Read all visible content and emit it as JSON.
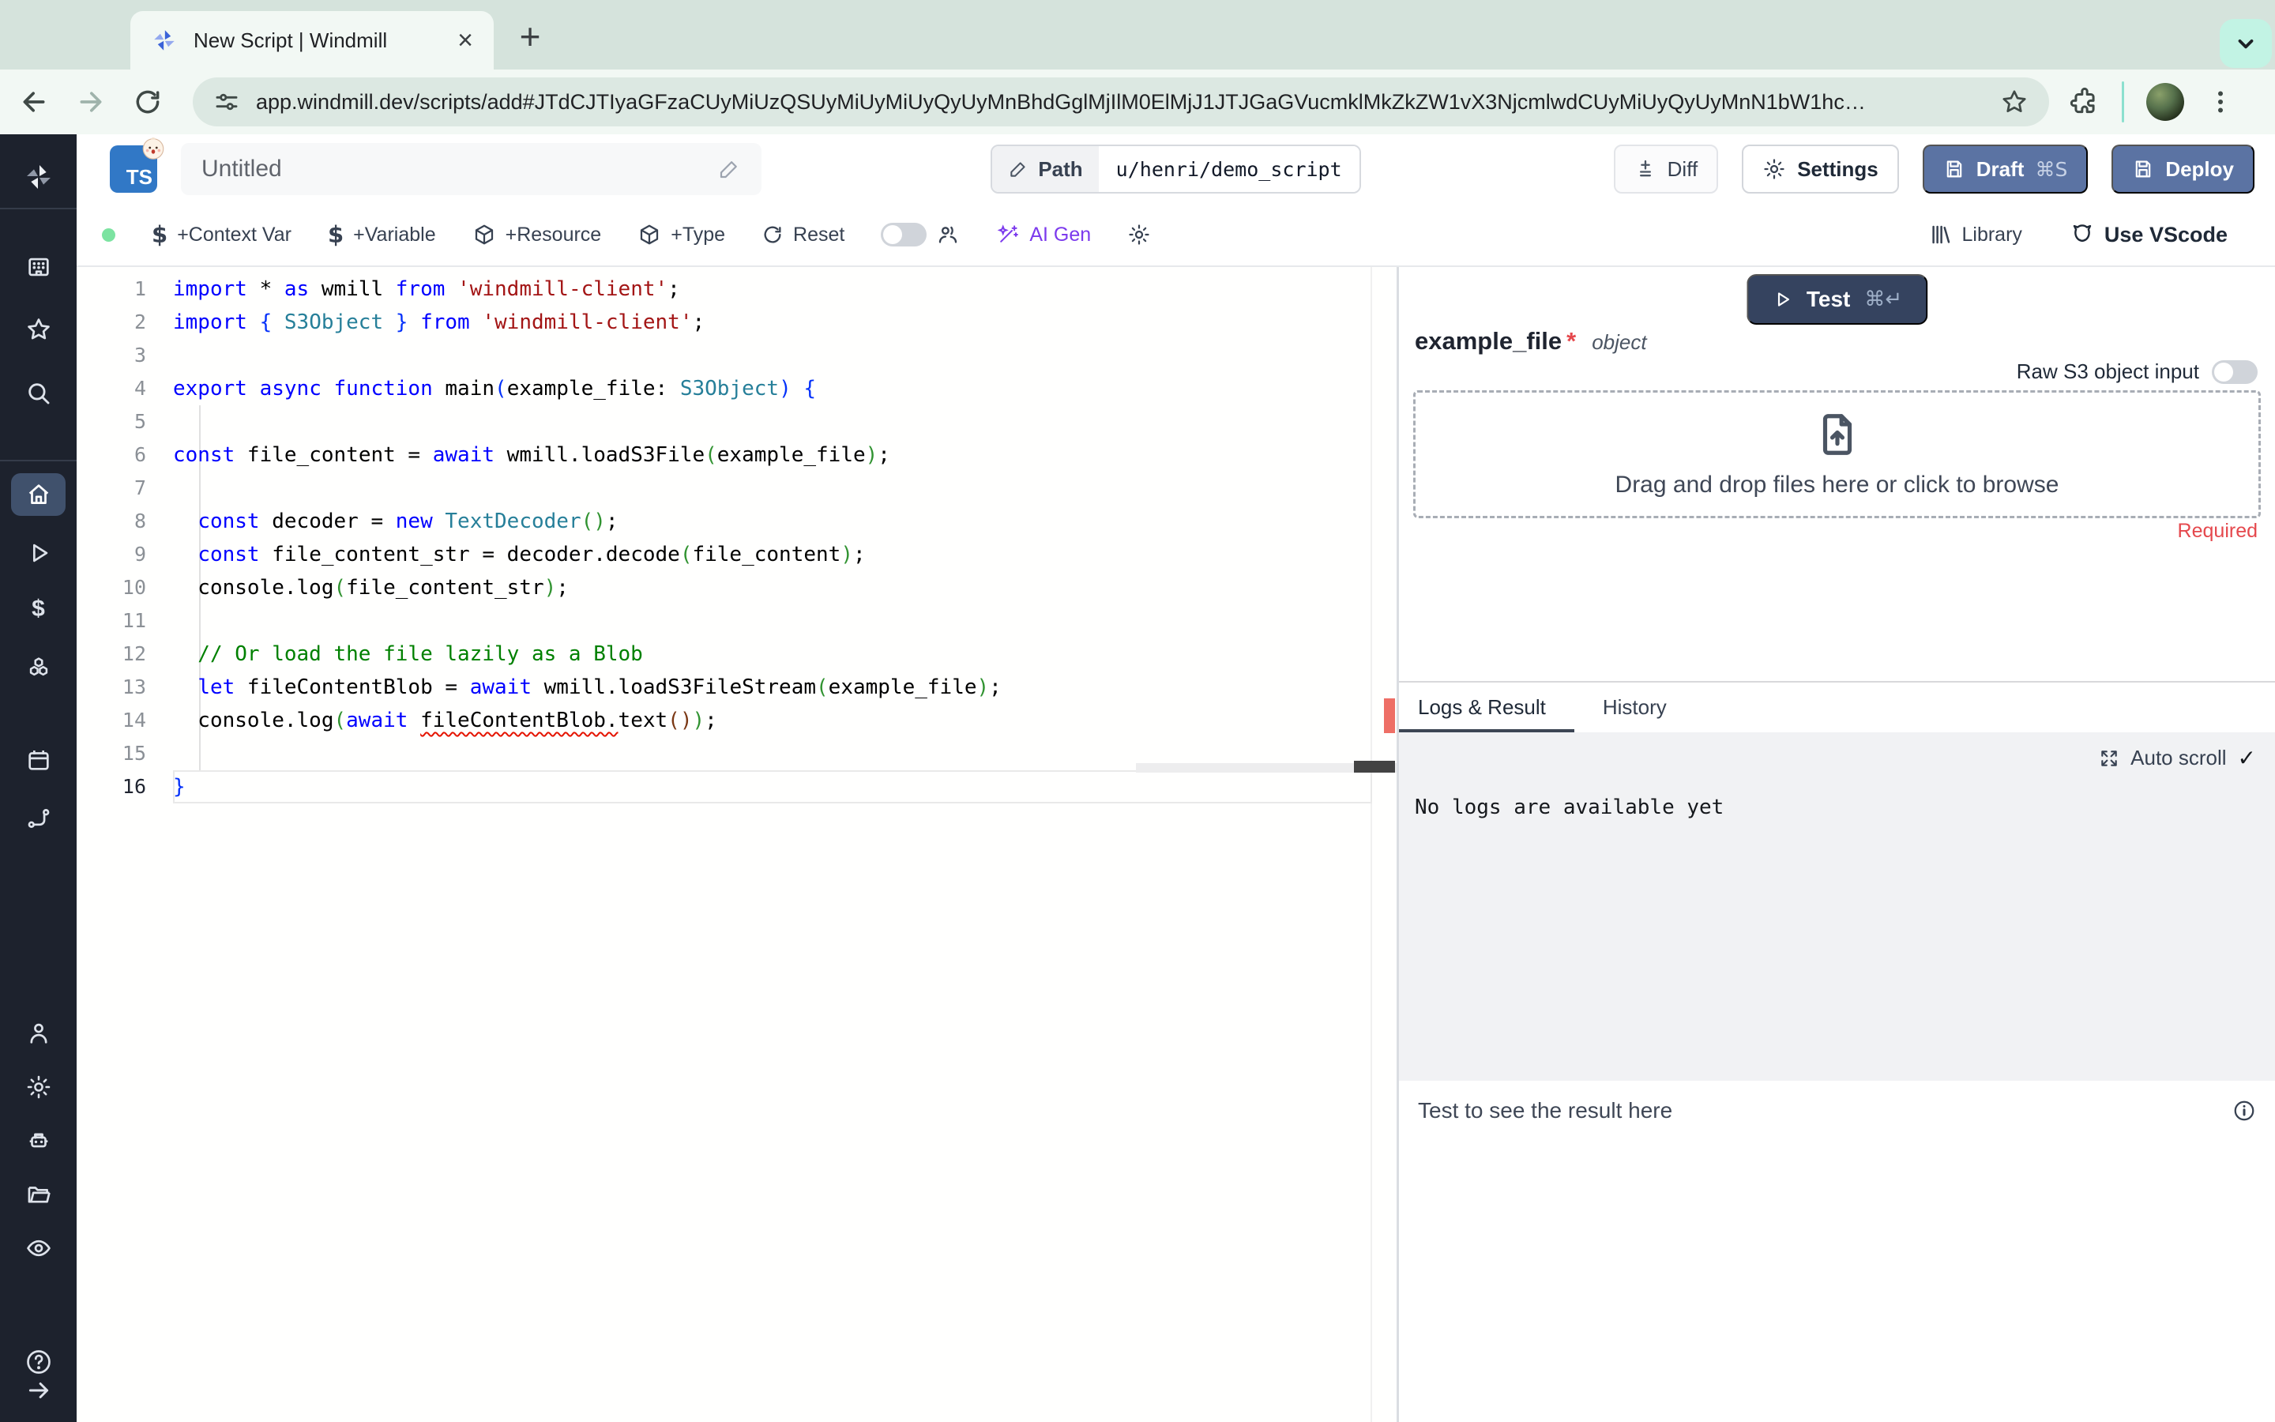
{
  "browser": {
    "tab_title": "New Script | Windmill",
    "url": "app.windmill.dev/scripts/add#JTdCJTIyaGFzaCUyMiUzQSUyMiUyMiUyQyUyMnBhdGglMjIlM0ElMjJ1JTJGaGVucmklMkZkZW1vX3NjcmlwdCUyMiUyQyUyMnN1bW1hc…"
  },
  "icons": {
    "close": "×",
    "plus": "+",
    "check": "✓",
    "arrow_right": "→",
    "help": "?",
    "dollar": "$"
  },
  "header": {
    "lang_badge": "TS",
    "name_value": "Untitled",
    "path_label": "Path",
    "path_value": "u/henri/demo_script",
    "diff_label": "Diff",
    "settings_label": "Settings",
    "draft_label": "Draft",
    "draft_shortcut": "⌘S",
    "deploy_label": "Deploy"
  },
  "toolbar": {
    "context_var": "+Context Var",
    "variable": "+Variable",
    "resource": "+Resource",
    "type": "+Type",
    "reset": "Reset",
    "ai_gen": "AI Gen",
    "library": "Library",
    "use_vscode": "Use VScode"
  },
  "editor": {
    "language": "typescript",
    "lines": [
      {
        "n": 1,
        "s": [
          [
            "kw",
            "import"
          ],
          [
            "pl",
            " * "
          ],
          [
            "kw",
            "as"
          ],
          [
            "pl",
            " wmill "
          ],
          [
            "kw",
            "from"
          ],
          [
            "pl",
            " "
          ],
          [
            "str",
            "'windmill-client'"
          ],
          [
            "pl",
            ";"
          ]
        ]
      },
      {
        "n": 2,
        "s": [
          [
            "kw",
            "import"
          ],
          [
            "pl",
            " "
          ],
          [
            "b0",
            "{"
          ],
          [
            "pl",
            " "
          ],
          [
            "type",
            "S3Object"
          ],
          [
            "pl",
            " "
          ],
          [
            "b0",
            "}"
          ],
          [
            "pl",
            " "
          ],
          [
            "kw",
            "from"
          ],
          [
            "pl",
            " "
          ],
          [
            "str",
            "'windmill-client'"
          ],
          [
            "pl",
            ";"
          ]
        ]
      },
      {
        "n": 3,
        "s": []
      },
      {
        "n": 4,
        "s": [
          [
            "kw",
            "export"
          ],
          [
            "pl",
            " "
          ],
          [
            "kw",
            "async"
          ],
          [
            "pl",
            " "
          ],
          [
            "kw",
            "function"
          ],
          [
            "pl",
            " main"
          ],
          [
            "b0",
            "("
          ],
          [
            "pl",
            "example_file: "
          ],
          [
            "type",
            "S3Object"
          ],
          [
            "b0",
            ")"
          ],
          [
            "pl",
            " "
          ],
          [
            "b0",
            "{"
          ]
        ]
      },
      {
        "n": 5,
        "s": []
      },
      {
        "n": 6,
        "s": [
          [
            "kw",
            "const"
          ],
          [
            "pl",
            " file_content = "
          ],
          [
            "kw",
            "await"
          ],
          [
            "pl",
            " wmill.loadS3File"
          ],
          [
            "b1",
            "("
          ],
          [
            "pl",
            "example_file"
          ],
          [
            "b1",
            ")"
          ],
          [
            "pl",
            ";"
          ]
        ]
      },
      {
        "n": 7,
        "s": []
      },
      {
        "n": 8,
        "s": [
          [
            "pl",
            "  "
          ],
          [
            "kw",
            "const"
          ],
          [
            "pl",
            " decoder = "
          ],
          [
            "kw",
            "new"
          ],
          [
            "pl",
            " "
          ],
          [
            "type",
            "TextDecoder"
          ],
          [
            "b1",
            "()"
          ],
          [
            "pl",
            ";"
          ]
        ]
      },
      {
        "n": 9,
        "s": [
          [
            "pl",
            "  "
          ],
          [
            "kw",
            "const"
          ],
          [
            "pl",
            " file_content_str = decoder.decode"
          ],
          [
            "b1",
            "("
          ],
          [
            "pl",
            "file_content"
          ],
          [
            "b1",
            ")"
          ],
          [
            "pl",
            ";"
          ]
        ]
      },
      {
        "n": 10,
        "s": [
          [
            "pl",
            "  console.log"
          ],
          [
            "b1",
            "("
          ],
          [
            "pl",
            "file_content_str"
          ],
          [
            "b1",
            ")"
          ],
          [
            "pl",
            ";"
          ]
        ]
      },
      {
        "n": 11,
        "s": []
      },
      {
        "n": 12,
        "s": [
          [
            "cmt",
            "  // Or load the file lazily as a Blob"
          ]
        ]
      },
      {
        "n": 13,
        "s": [
          [
            "pl",
            "  "
          ],
          [
            "kw",
            "let"
          ],
          [
            "pl",
            " fileContentBlob = "
          ],
          [
            "kw",
            "await"
          ],
          [
            "pl",
            " wmill.loadS3FileStream"
          ],
          [
            "b1",
            "("
          ],
          [
            "pl",
            "example_file"
          ],
          [
            "b1",
            ")"
          ],
          [
            "pl",
            ";"
          ]
        ]
      },
      {
        "n": 14,
        "s": [
          [
            "pl",
            "  console.log"
          ],
          [
            "b1",
            "("
          ],
          [
            "kw",
            "await"
          ],
          [
            "pl",
            " "
          ],
          [
            "sq",
            "fileContentBlob."
          ],
          [
            "pl",
            "text"
          ],
          [
            "b2",
            "()"
          ],
          [
            "b1",
            ")"
          ],
          [
            "pl",
            ";"
          ]
        ]
      },
      {
        "n": 15,
        "s": []
      },
      {
        "n": 16,
        "cur": true,
        "s": [
          [
            "b0",
            "}"
          ]
        ]
      }
    ]
  },
  "right_panel": {
    "test_label": "Test",
    "test_shortcut": "⌘↵",
    "arg_name": "example_file",
    "arg_required_mark": "*",
    "arg_type": "object",
    "raw_s3_label": "Raw S3 object input",
    "dropzone_text": "Drag and drop files here or click to browse",
    "required_label": "Required",
    "tabs": {
      "logs": "Logs & Result",
      "history": "History"
    },
    "auto_scroll_label": "Auto scroll",
    "no_logs_text": "No logs are available yet",
    "result_placeholder": "Test to see the result here"
  },
  "colors": {
    "draft_deploy_blue": "#5b73a3",
    "test_navy": "#35435f",
    "ai_purple": "#7c3aed",
    "required_red": "#e5484d",
    "presence_green": "#7ce3a1",
    "sidebar_bg": "#1d222d",
    "tabstrip_sage": "#d5e3dc",
    "mint_button": "#c2f3e4"
  }
}
